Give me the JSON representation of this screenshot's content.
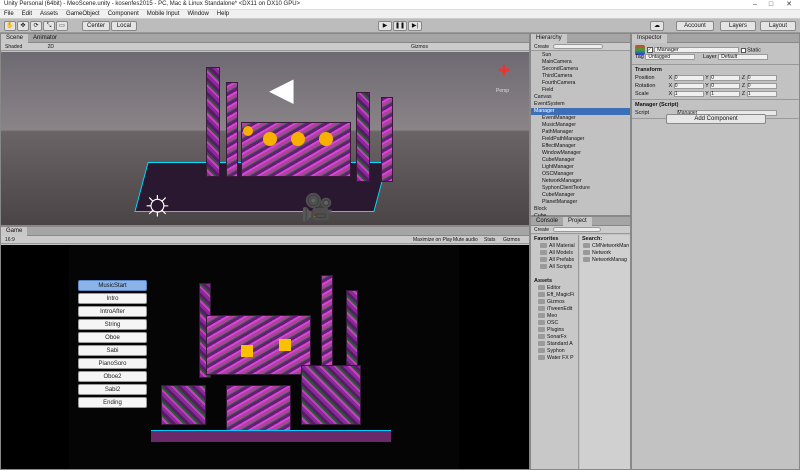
{
  "window": {
    "title": "Unity Personal (64bit) - MeoScene.unity - kosenfes2015 - PC, Mac & Linux Standalone* <DX11 on DX10 GPU>"
  },
  "menu": [
    "File",
    "Edit",
    "Assets",
    "GameObject",
    "Component",
    "Mobile Input",
    "Window",
    "Help"
  ],
  "toolbar": {
    "center": "Center",
    "local": "Local",
    "account": "Account",
    "layers": "Layers",
    "layout": "Layout"
  },
  "scene": {
    "tab_scene": "Scene",
    "tab_animator": "Animator",
    "shading": "Shaded",
    "mode_2d": "2D",
    "gizmos": "Gizmos",
    "persp": "Persp"
  },
  "game": {
    "tab": "Game",
    "aspect": "16:9",
    "maximize": "Maximize on Play",
    "mute": "Mute audio",
    "stats": "Stats",
    "gizmos": "Gizmos",
    "buttons": [
      "MusicStart",
      "Intro",
      "IntroAfter",
      "String",
      "Oboe",
      "Sabi",
      "PianoSoro",
      "Oboe2",
      "Sabi2",
      "Ending"
    ]
  },
  "hierarchy": {
    "tab": "Hierarchy",
    "create": "Create",
    "items": [
      {
        "label": "Sun",
        "indent": 1
      },
      {
        "label": "MainCamera",
        "indent": 1
      },
      {
        "label": "SecondCamera",
        "indent": 1
      },
      {
        "label": "ThirdCamera",
        "indent": 1
      },
      {
        "label": "FourthCamera",
        "indent": 1
      },
      {
        "label": "Field",
        "indent": 1
      },
      {
        "label": "Canvas",
        "indent": 0
      },
      {
        "label": "EventSystem",
        "indent": 0
      },
      {
        "label": "Manager",
        "indent": 0
      },
      {
        "label": "EventManager",
        "indent": 1
      },
      {
        "label": "MusicManager",
        "indent": 1
      },
      {
        "label": "PathManager",
        "indent": 1
      },
      {
        "label": "FieldPathManager",
        "indent": 1
      },
      {
        "label": "EffectManager",
        "indent": 1
      },
      {
        "label": "WindowManager",
        "indent": 1
      },
      {
        "label": "CubeManager",
        "indent": 1
      },
      {
        "label": "LightManager",
        "indent": 1
      },
      {
        "label": "OSCManager",
        "indent": 1
      },
      {
        "label": "NetworkManager",
        "indent": 1
      },
      {
        "label": "SyphonClientTexture",
        "indent": 1
      },
      {
        "label": "CubeManager",
        "indent": 1
      },
      {
        "label": "PlanetManager",
        "indent": 1
      },
      {
        "label": "Block",
        "indent": 0
      },
      {
        "label": "Cube",
        "indent": 0
      }
    ]
  },
  "console": {
    "tab_console": "Console",
    "tab_project": "Project",
    "create": "Create",
    "search": "Search:",
    "assets": "Assets",
    "favorites_label": "Favorites",
    "favorites": [
      "All Material",
      "All Models",
      "All Prefabs",
      "All Scripts"
    ],
    "folders": [
      "Editor",
      "Eff_MagicFi",
      "Gizmos",
      "iTweenEdit",
      "Meo",
      "OSC",
      "Plugins",
      "SonarFx",
      "Standard A",
      "Syphon",
      "Water FX P"
    ],
    "results": [
      "CMNetworkMan",
      "Network",
      "NetworkManag"
    ]
  },
  "inspector": {
    "tab": "Inspector",
    "name": "Manager",
    "static": "Static",
    "tag_label": "Tag",
    "tag": "Untagged",
    "layer_label": "Layer",
    "layer": "Default",
    "transform": "Transform",
    "position": {
      "label": "Position",
      "x": "0",
      "y": "0",
      "z": "0"
    },
    "rotation": {
      "label": "Rotation",
      "x": "0",
      "y": "0",
      "z": "0"
    },
    "scale": {
      "label": "Scale",
      "x": "1",
      "y": "1",
      "z": "1"
    },
    "script_component": "Manager (Script)",
    "script_label": "Script",
    "script_value": "Manager",
    "add_component": "Add Component"
  },
  "colors": {
    "accent": "#8ab4e8",
    "select": "#3d6fb6"
  }
}
